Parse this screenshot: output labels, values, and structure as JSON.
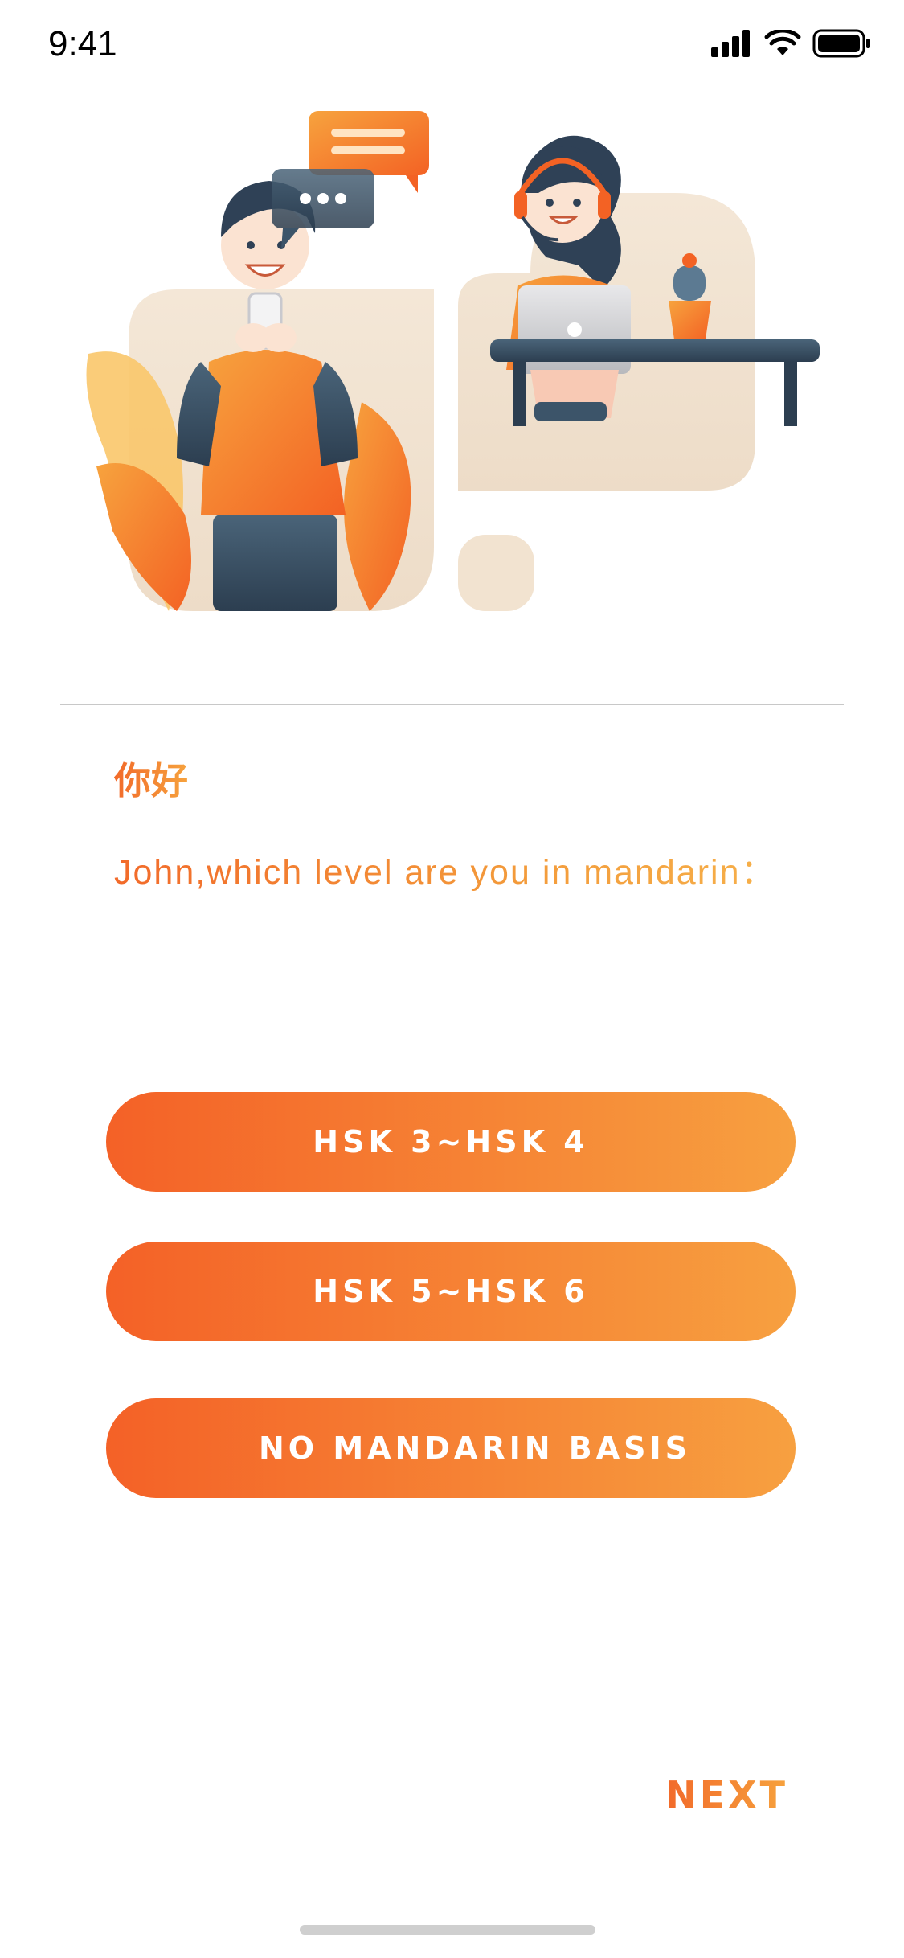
{
  "status_bar": {
    "time": "9:41"
  },
  "content": {
    "greeting": "你好",
    "question": "John,which level are you in mandarin："
  },
  "options": [
    {
      "label": "HSK 3~HSK 4"
    },
    {
      "label": "HSK 5~HSK 6"
    },
    {
      "label": "NO MANDARIN BASIS"
    }
  ],
  "footer": {
    "next_label": "NEXT"
  },
  "colors": {
    "accent_start": "#F46127",
    "accent_end": "#F7A040"
  },
  "illustration": {
    "subject": "two-people-chat-illustration"
  }
}
